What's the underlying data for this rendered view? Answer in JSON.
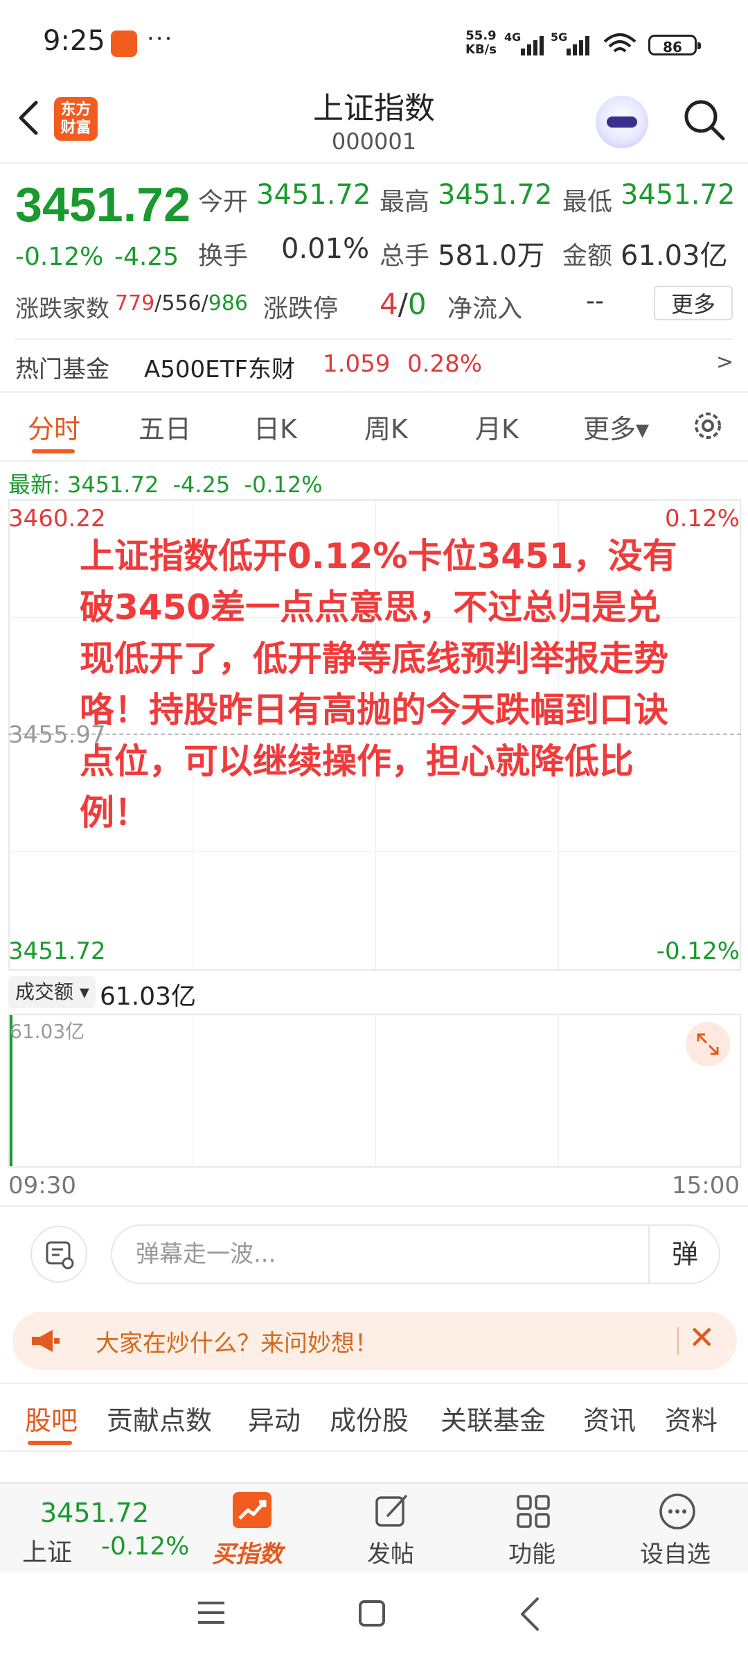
{
  "status_bar": {
    "time": "9:25",
    "dots": "···",
    "net_speed_top": "55.9",
    "net_speed_bottom": "KB/s",
    "net1": "4G",
    "net2": "5G",
    "battery": "86"
  },
  "header": {
    "logo_line1": "东方",
    "logo_line2": "财富",
    "title": "上证指数",
    "code": "000001"
  },
  "quote": {
    "price": "3451.72",
    "change_pct": "-0.12%",
    "change": "-4.25",
    "open_label": "今开",
    "open": "3451.72",
    "high_label": "最高",
    "high": "3451.72",
    "low_label": "最低",
    "low": "3451.72",
    "turnover_label": "换手",
    "turnover": "0.01%",
    "volume_label": "总手",
    "volume": "581.0万",
    "amount_label": "金额",
    "amount": "61.03亿",
    "breadth_label": "涨跌家数",
    "breadth_up": "779",
    "breadth_flat": "556",
    "breadth_down": "986",
    "slash": "/",
    "limit_label": "涨跌停",
    "limit_up": "4",
    "limit_down": "0",
    "flow_label": "净流入",
    "flow_value": "--",
    "more_label": "更多"
  },
  "hot_fund": {
    "label": "热门基金",
    "name": "A500ETF东财",
    "price": "1.059",
    "pct": "0.28%",
    "arrow": ">"
  },
  "chart_tabs": {
    "items": [
      "分时",
      "五日",
      "日K",
      "周K",
      "月K",
      "更多▾"
    ]
  },
  "latest": {
    "label": "最新:",
    "price": "3451.72",
    "change": "-4.25",
    "pct": "-0.12%"
  },
  "chart": {
    "y_top": "3460.22",
    "y_mid": "3455.97",
    "y_bottom": "3451.72",
    "y_right_top": "0.12%",
    "y_right_bottom": "-0.12%",
    "comment": "上证指数低开0.12%卡位3451，没有破3450差一点点意思，不过总归是兑现低开了，低开静等底线预判举报走势咯！持股昨日有高抛的今天跌幅到口诀点位，可以继续操作，担心就降低比例！"
  },
  "volume": {
    "selector": "成交额 ▾",
    "value": "61.03亿",
    "max_label": "61.03亿",
    "t_start": "09:30",
    "t_end": "15:00"
  },
  "danmaku": {
    "placeholder": "弹幕走一波...",
    "toggle": "弹"
  },
  "ask_banner": {
    "text": "大家在炒什么？来问妙想！",
    "close": "✕"
  },
  "bottom_tabs": {
    "items": [
      "股吧",
      "贡献点数",
      "异动",
      "成份股",
      "关联基金",
      "资讯",
      "资料"
    ]
  },
  "toolbar": {
    "price": "3451.72",
    "market": "上证",
    "pct": "-0.12%",
    "buy_label": "买指数",
    "post_label": "发帖",
    "func_label": "功能",
    "watch_label": "设自选"
  },
  "colors": {
    "down_green": "#1a9a2e",
    "up_red": "#e03a3a",
    "brand_orange": "#f25c1f"
  }
}
